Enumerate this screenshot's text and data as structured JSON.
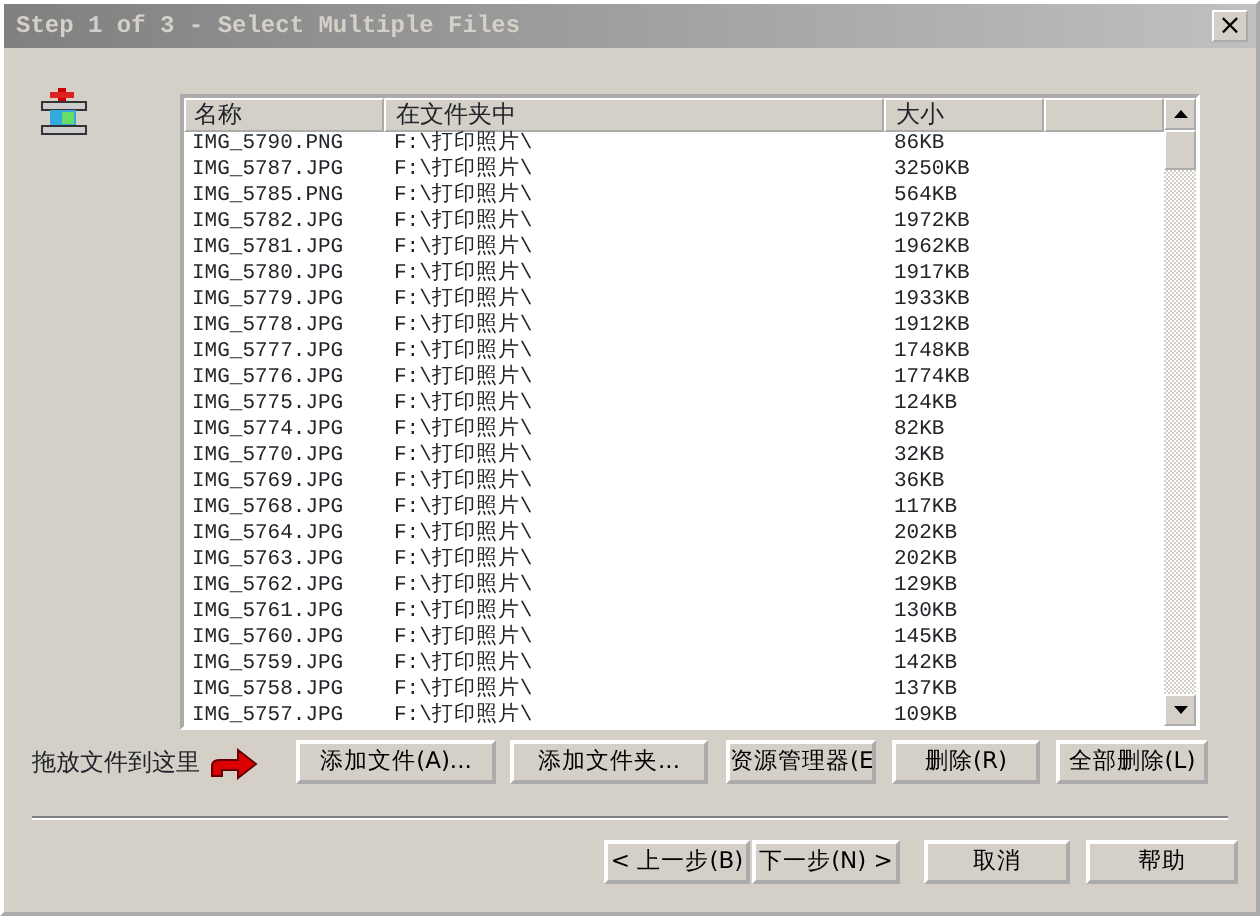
{
  "window": {
    "title": "Step 1 of 3 - Select Multiple Files",
    "close": "×"
  },
  "file_list": {
    "columns": [
      "名称",
      "在文件夹中",
      "大小"
    ],
    "rows": [
      {
        "name": "IMG_5790.PNG",
        "folder": "F:\\打印照片\\",
        "size": "86KB"
      },
      {
        "name": "IMG_5787.JPG",
        "folder": "F:\\打印照片\\",
        "size": "3250KB"
      },
      {
        "name": "IMG_5785.PNG",
        "folder": "F:\\打印照片\\",
        "size": "564KB"
      },
      {
        "name": "IMG_5782.JPG",
        "folder": "F:\\打印照片\\",
        "size": "1972KB"
      },
      {
        "name": "IMG_5781.JPG",
        "folder": "F:\\打印照片\\",
        "size": "1962KB"
      },
      {
        "name": "IMG_5780.JPG",
        "folder": "F:\\打印照片\\",
        "size": "1917KB"
      },
      {
        "name": "IMG_5779.JPG",
        "folder": "F:\\打印照片\\",
        "size": "1933KB"
      },
      {
        "name": "IMG_5778.JPG",
        "folder": "F:\\打印照片\\",
        "size": "1912KB"
      },
      {
        "name": "IMG_5777.JPG",
        "folder": "F:\\打印照片\\",
        "size": "1748KB"
      },
      {
        "name": "IMG_5776.JPG",
        "folder": "F:\\打印照片\\",
        "size": "1774KB"
      },
      {
        "name": "IMG_5775.JPG",
        "folder": "F:\\打印照片\\",
        "size": "124KB"
      },
      {
        "name": "IMG_5774.JPG",
        "folder": "F:\\打印照片\\",
        "size": "82KB"
      },
      {
        "name": "IMG_5770.JPG",
        "folder": "F:\\打印照片\\",
        "size": "32KB"
      },
      {
        "name": "IMG_5769.JPG",
        "folder": "F:\\打印照片\\",
        "size": "36KB"
      },
      {
        "name": "IMG_5768.JPG",
        "folder": "F:\\打印照片\\",
        "size": "117KB"
      },
      {
        "name": "IMG_5764.JPG",
        "folder": "F:\\打印照片\\",
        "size": "202KB"
      },
      {
        "name": "IMG_5763.JPG",
        "folder": "F:\\打印照片\\",
        "size": "202KB"
      },
      {
        "name": "IMG_5762.JPG",
        "folder": "F:\\打印照片\\",
        "size": "129KB"
      },
      {
        "name": "IMG_5761.JPG",
        "folder": "F:\\打印照片\\",
        "size": "130KB"
      },
      {
        "name": "IMG_5760.JPG",
        "folder": "F:\\打印照片\\",
        "size": "145KB"
      },
      {
        "name": "IMG_5759.JPG",
        "folder": "F:\\打印照片\\",
        "size": "142KB"
      },
      {
        "name": "IMG_5758.JPG",
        "folder": "F:\\打印照片\\",
        "size": "137KB"
      },
      {
        "name": "IMG_5757.JPG",
        "folder": "F:\\打印照片\\",
        "size": "109KB"
      }
    ]
  },
  "drop_hint": "拖放文件到这里",
  "action_buttons": [
    "添加文件(A)...",
    "添加文件夹...",
    "资源管理器(E",
    "删除(R)",
    "全部删除(L)"
  ],
  "nav_buttons": [
    "< 上一步(B)",
    "下一步(N) >",
    "取消",
    "帮助"
  ]
}
